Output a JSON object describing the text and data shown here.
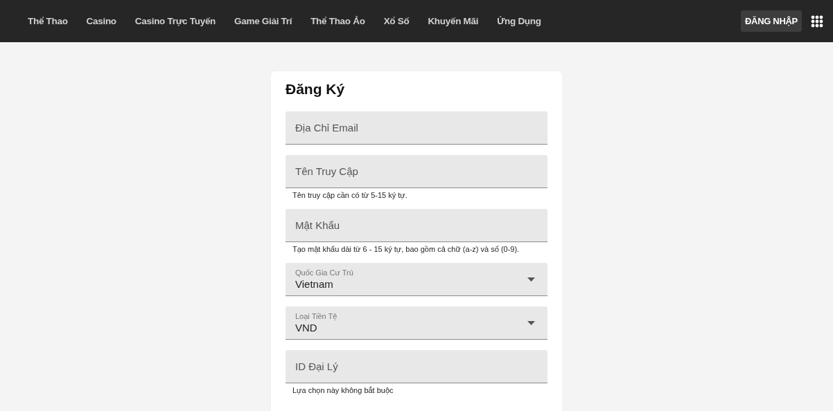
{
  "nav": {
    "items": [
      {
        "label": "Thể Thao"
      },
      {
        "label": "Casino"
      },
      {
        "label": "Casino Trực Tuyến"
      },
      {
        "label": "Game Giải Trí"
      },
      {
        "label": "Thể Thao Ảo"
      },
      {
        "label": "Xổ Số"
      },
      {
        "label": "Khuyến Mãi"
      },
      {
        "label": "Ứng Dụng"
      }
    ],
    "login_button": "ĐĂNG NHẬP"
  },
  "form": {
    "title": "Đăng Ký",
    "fields": [
      {
        "kind": "text",
        "placeholder": "Địa Chỉ Email"
      },
      {
        "kind": "text",
        "placeholder": "Tên Truy Cập",
        "hint": "Tên truy cập cần có từ 5-15 ký tự."
      },
      {
        "kind": "text",
        "placeholder": "Mật Khẩu",
        "hint": "Tạo mật khẩu dài từ 6 - 15 ký tự, bao gồm cả chữ (a-z) và số (0-9)."
      },
      {
        "kind": "select",
        "label": "Quốc Gia Cư Trú",
        "value": "Vietnam"
      },
      {
        "kind": "select",
        "label": "Loại Tiền Tệ",
        "value": "VND"
      },
      {
        "kind": "text",
        "placeholder": "ID Đại Lý",
        "hint": "Lựa chọn này không bắt buộc"
      }
    ]
  }
}
